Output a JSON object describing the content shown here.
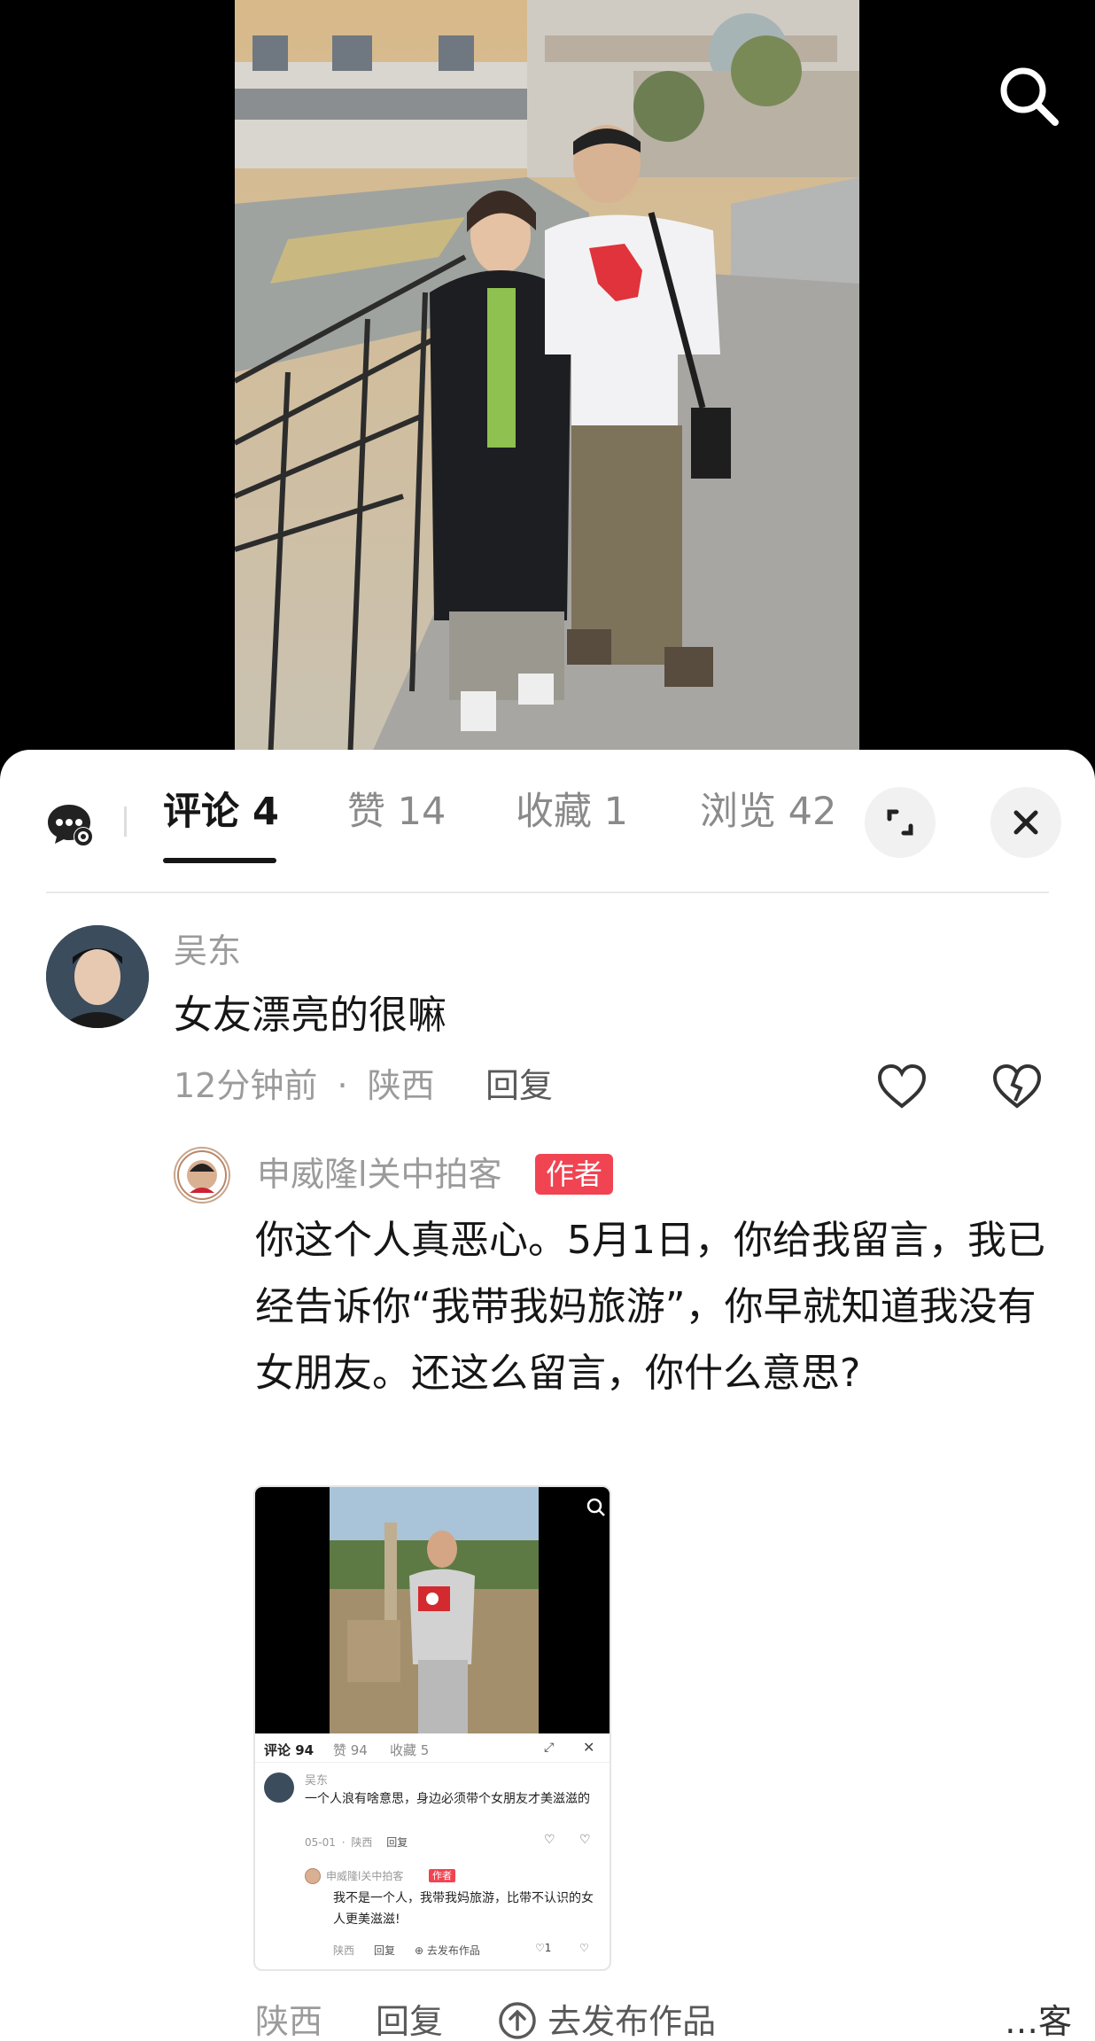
{
  "icons": {
    "search": "search-icon",
    "comment_settings": "comment-settings-icon",
    "expand": "expand-icon",
    "close": "close-icon",
    "like": "heart-outline-icon",
    "dislike": "broken-heart-icon",
    "publish": "upload-circle-icon"
  },
  "colors": {
    "author_badge": "#f04452",
    "active_tab": "#161616",
    "muted_text": "#9b9b9b"
  },
  "tabs": [
    {
      "label": "评论 4",
      "active": true
    },
    {
      "label": "赞 14",
      "active": false
    },
    {
      "label": "收藏 1",
      "active": false
    },
    {
      "label": "浏览 42",
      "active": false
    }
  ],
  "comment": {
    "username": "吴东",
    "text": "女友漂亮的很嘛",
    "time": "12分钟前",
    "separator": "·",
    "location": "陕西",
    "reply_label": "回复"
  },
  "author_reply": {
    "username": "申威隆l关中拍客",
    "badge": "作者",
    "text": "你这个人真恶心。5月1日，你给我留言，我已经告诉你“我带我妈旅游”，你早就知道我没有女朋友。还这么留言，你什么意思?",
    "location": "陕西",
    "reply_label": "回复",
    "publish_label": "去发布作品",
    "cut_off_text": "…客"
  },
  "thumbnail": {
    "tabs": [
      "评论 94",
      "赞 94",
      "收藏 5"
    ],
    "comment": {
      "username": "吴东",
      "text": "一个人浪有啥意思，身边必须带个女朋友才美滋滋的",
      "date": "05-01",
      "separator": "·",
      "location": "陕西",
      "reply_label": "回复"
    },
    "reply": {
      "username": "申威隆l关中拍客",
      "badge": "作者",
      "text": "我不是一个人，我带我妈旅游，比带不认识的女人更美滋滋!",
      "location": "陕西",
      "reply_label": "回复",
      "publish_label": "去发布作品",
      "like_count": "1"
    }
  }
}
